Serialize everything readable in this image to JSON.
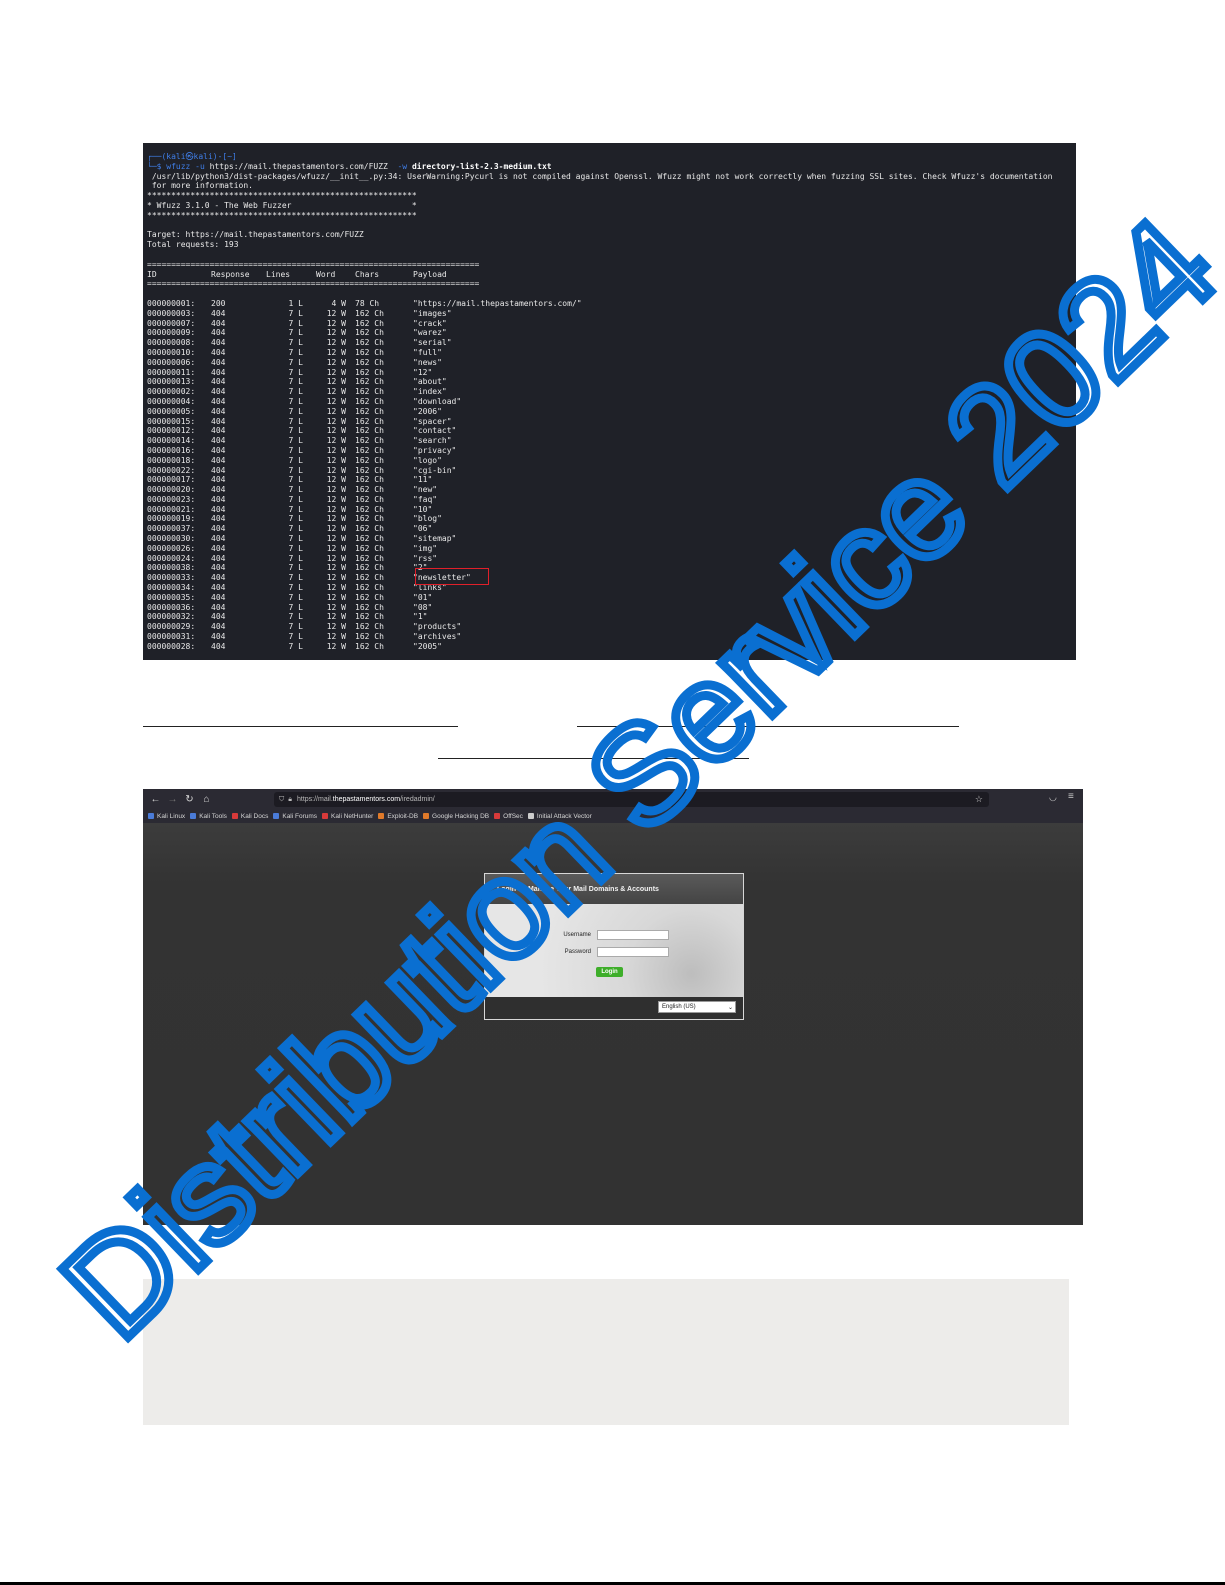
{
  "terminal": {
    "prompt_line": "┌──(kali㉿kali)-[~]",
    "cmd_prefix": "└─$ ",
    "cmd_name": "wfuzz",
    "cmd_flag_u": " -u ",
    "cmd_url": "https://mail.thepastamentors.com/FUZZ",
    "cmd_flag_w": "  -w ",
    "cmd_wordlist": "directory-list-2.3-medium.txt",
    "warning_1": " /usr/lib/python3/dist-packages/wfuzz/__init__.py:34: UserWarning:Pycurl is not compiled against Openssl. Wfuzz might not work correctly when fuzzing SSL sites. Check Wfuzz's documentation",
    "warning_2": " for more information.",
    "stars_1": "********************************************************",
    "banner": "* Wfuzz 3.1.0 - The Web Fuzzer                         *",
    "stars_2": "********************************************************",
    "target": "Target: https://mail.thepastamentors.com/FUZZ",
    "total": "Total requests: 193",
    "equals_1": "=====================================================================",
    "headers": [
      "ID",
      "Response",
      "Lines",
      "Word",
      "Chars",
      "Payload"
    ],
    "equals_2": "=====================================================================",
    "rows": [
      [
        "000000001:",
        "200",
        "1 L",
        "4 W",
        "78 Ch",
        "\"https://mail.thepastamentors.com/\""
      ],
      [
        "000000003:",
        "404",
        "7 L",
        "12 W",
        "162 Ch",
        "\"images\""
      ],
      [
        "000000007:",
        "404",
        "7 L",
        "12 W",
        "162 Ch",
        "\"crack\""
      ],
      [
        "000000009:",
        "404",
        "7 L",
        "12 W",
        "162 Ch",
        "\"warez\""
      ],
      [
        "000000008:",
        "404",
        "7 L",
        "12 W",
        "162 Ch",
        "\"serial\""
      ],
      [
        "000000010:",
        "404",
        "7 L",
        "12 W",
        "162 Ch",
        "\"full\""
      ],
      [
        "000000006:",
        "404",
        "7 L",
        "12 W",
        "162 Ch",
        "\"news\""
      ],
      [
        "000000011:",
        "404",
        "7 L",
        "12 W",
        "162 Ch",
        "\"12\""
      ],
      [
        "000000013:",
        "404",
        "7 L",
        "12 W",
        "162 Ch",
        "\"about\""
      ],
      [
        "000000002:",
        "404",
        "7 L",
        "12 W",
        "162 Ch",
        "\"index\""
      ],
      [
        "000000004:",
        "404",
        "7 L",
        "12 W",
        "162 Ch",
        "\"download\""
      ],
      [
        "000000005:",
        "404",
        "7 L",
        "12 W",
        "162 Ch",
        "\"2006\""
      ],
      [
        "000000015:",
        "404",
        "7 L",
        "12 W",
        "162 Ch",
        "\"spacer\""
      ],
      [
        "000000012:",
        "404",
        "7 L",
        "12 W",
        "162 Ch",
        "\"contact\""
      ],
      [
        "000000014:",
        "404",
        "7 L",
        "12 W",
        "162 Ch",
        "\"search\""
      ],
      [
        "000000016:",
        "404",
        "7 L",
        "12 W",
        "162 Ch",
        "\"privacy\""
      ],
      [
        "000000018:",
        "404",
        "7 L",
        "12 W",
        "162 Ch",
        "\"logo\""
      ],
      [
        "000000022:",
        "404",
        "7 L",
        "12 W",
        "162 Ch",
        "\"cgi-bin\""
      ],
      [
        "000000017:",
        "404",
        "7 L",
        "12 W",
        "162 Ch",
        "\"11\""
      ],
      [
        "000000020:",
        "404",
        "7 L",
        "12 W",
        "162 Ch",
        "\"new\""
      ],
      [
        "000000023:",
        "404",
        "7 L",
        "12 W",
        "162 Ch",
        "\"faq\""
      ],
      [
        "000000021:",
        "404",
        "7 L",
        "12 W",
        "162 Ch",
        "\"10\""
      ],
      [
        "000000019:",
        "404",
        "7 L",
        "12 W",
        "162 Ch",
        "\"blog\""
      ],
      [
        "000000037:",
        "404",
        "7 L",
        "12 W",
        "162 Ch",
        "\"06\""
      ],
      [
        "000000030:",
        "404",
        "7 L",
        "12 W",
        "162 Ch",
        "\"sitemap\""
      ],
      [
        "000000026:",
        "404",
        "7 L",
        "12 W",
        "162 Ch",
        "\"img\""
      ],
      [
        "000000024:",
        "404",
        "7 L",
        "12 W",
        "162 Ch",
        "\"rss\""
      ],
      [
        "000000038:",
        "404",
        "7 L",
        "12 W",
        "162 Ch",
        "\"2\""
      ],
      [
        "000000033:",
        "404",
        "7 L",
        "12 W",
        "162 Ch",
        "\"newsletter\""
      ],
      [
        "000000034:",
        "404",
        "7 L",
        "12 W",
        "162 Ch",
        "\"links\""
      ],
      [
        "000000035:",
        "404",
        "7 L",
        "12 W",
        "162 Ch",
        "\"01\""
      ],
      [
        "000000036:",
        "404",
        "7 L",
        "12 W",
        "162 Ch",
        "\"08\""
      ],
      [
        "000000032:",
        "404",
        "7 L",
        "12 W",
        "162 Ch",
        "\"1\""
      ],
      [
        "000000029:",
        "404",
        "7 L",
        "12 W",
        "162 Ch",
        "\"products\""
      ],
      [
        "000000031:",
        "404",
        "7 L",
        "12 W",
        "162 Ch",
        "\"archives\""
      ],
      [
        "000000028:",
        "404",
        "7 L",
        "12 W",
        "162 Ch",
        "\"2005\""
      ]
    ],
    "highlighted_payload": "\"newsletter\"",
    "highlight_color": "#e0202a"
  },
  "browser": {
    "nav": {
      "back": "←",
      "forward": "→",
      "reload": "↻",
      "home": "⌂"
    },
    "url_prefix": "https://mail.",
    "url_host": "thepastamentors.com",
    "url_path": "/iredadmin/",
    "bookmarks": [
      {
        "label": "Kali Linux",
        "color": "#4a7bd8"
      },
      {
        "label": "Kali Tools",
        "color": "#4a7bd8"
      },
      {
        "label": "Kali Docs",
        "color": "#d83a3a"
      },
      {
        "label": "Kali Forums",
        "color": "#4a7bd8"
      },
      {
        "label": "Kali NetHunter",
        "color": "#d83a3a"
      },
      {
        "label": "Exploit-DB",
        "color": "#e07a2a"
      },
      {
        "label": "Google Hacking DB",
        "color": "#e07a2a"
      },
      {
        "label": "OffSec",
        "color": "#d83a3a"
      },
      {
        "label": "Initial Attack Vector",
        "color": "#cccccc"
      }
    ],
    "login": {
      "title": "Login To Manage Your Mail Domains & Accounts",
      "username_label": "Username",
      "password_label": "Password",
      "button": "Login",
      "language": "English (US)"
    }
  },
  "watermark": {
    "text": "Distribution Service 2024",
    "color": "#0a6fd1"
  }
}
